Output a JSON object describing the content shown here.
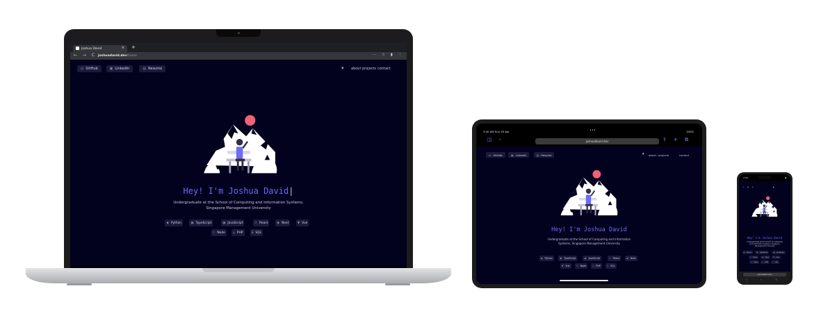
{
  "laptop": {
    "tab_title": "Joshua David",
    "tab_close": "×",
    "new_tab": "+",
    "nav_controls": "← → C",
    "url_host": "joshuadavid.dev",
    "url_path": "/home",
    "toolbar_icons": "⋯ ☆ ▮ ⋮"
  },
  "tablet": {
    "status_time": "3:40 AM  Sun 20 Apr",
    "status_right": "100%",
    "dots": "•••",
    "safari_left": "◫ ‹",
    "url": "joshuadavid.dev",
    "safari_right": "⇪ + ⧉"
  },
  "phone": {
    "status_time": "3:40",
    "status_right": "▮",
    "url": "joshuadavid.dev",
    "bottom_icons": "‹ › ⇪ ▯"
  },
  "site": {
    "nav_left": [
      {
        "icon": "github-icon",
        "glyph": "◎",
        "label": "GitHub"
      },
      {
        "icon": "linkedin-icon",
        "glyph": "▣",
        "label": "LinkedIn"
      },
      {
        "icon": "resume-icon",
        "glyph": "▤",
        "label": "Resume"
      }
    ],
    "theme_icon": "☀",
    "nav_right": [
      "about",
      "projects",
      "contact"
    ],
    "greeting": "Hey! I'm Joshua David",
    "greeting_cursor": "|",
    "bio": "Undergraduate at the School of Computing and Information Systems, Singapore Management University",
    "skills": [
      {
        "icon": "python-icon",
        "glyph": "◆",
        "label": "Python"
      },
      {
        "icon": "typescript-icon",
        "glyph": "▣",
        "label": "TypeScript"
      },
      {
        "icon": "javascript-icon",
        "glyph": "▣",
        "label": "JavaScript"
      },
      {
        "icon": "react-icon",
        "glyph": "⚛",
        "label": "React"
      },
      {
        "icon": "next-icon",
        "glyph": "◉",
        "label": "Next"
      },
      {
        "icon": "vue-icon",
        "glyph": "▼",
        "label": "Vue"
      },
      {
        "icon": "node-icon",
        "glyph": "⬡",
        "label": "Node"
      },
      {
        "icon": "php-icon",
        "glyph": "⟂",
        "label": "PHP"
      },
      {
        "icon": "sql-icon",
        "glyph": "⌸",
        "label": "SQL"
      }
    ]
  },
  "colors": {
    "site_background": "#02011e",
    "accent": "#6d6cf5",
    "sun": "#f06277"
  }
}
